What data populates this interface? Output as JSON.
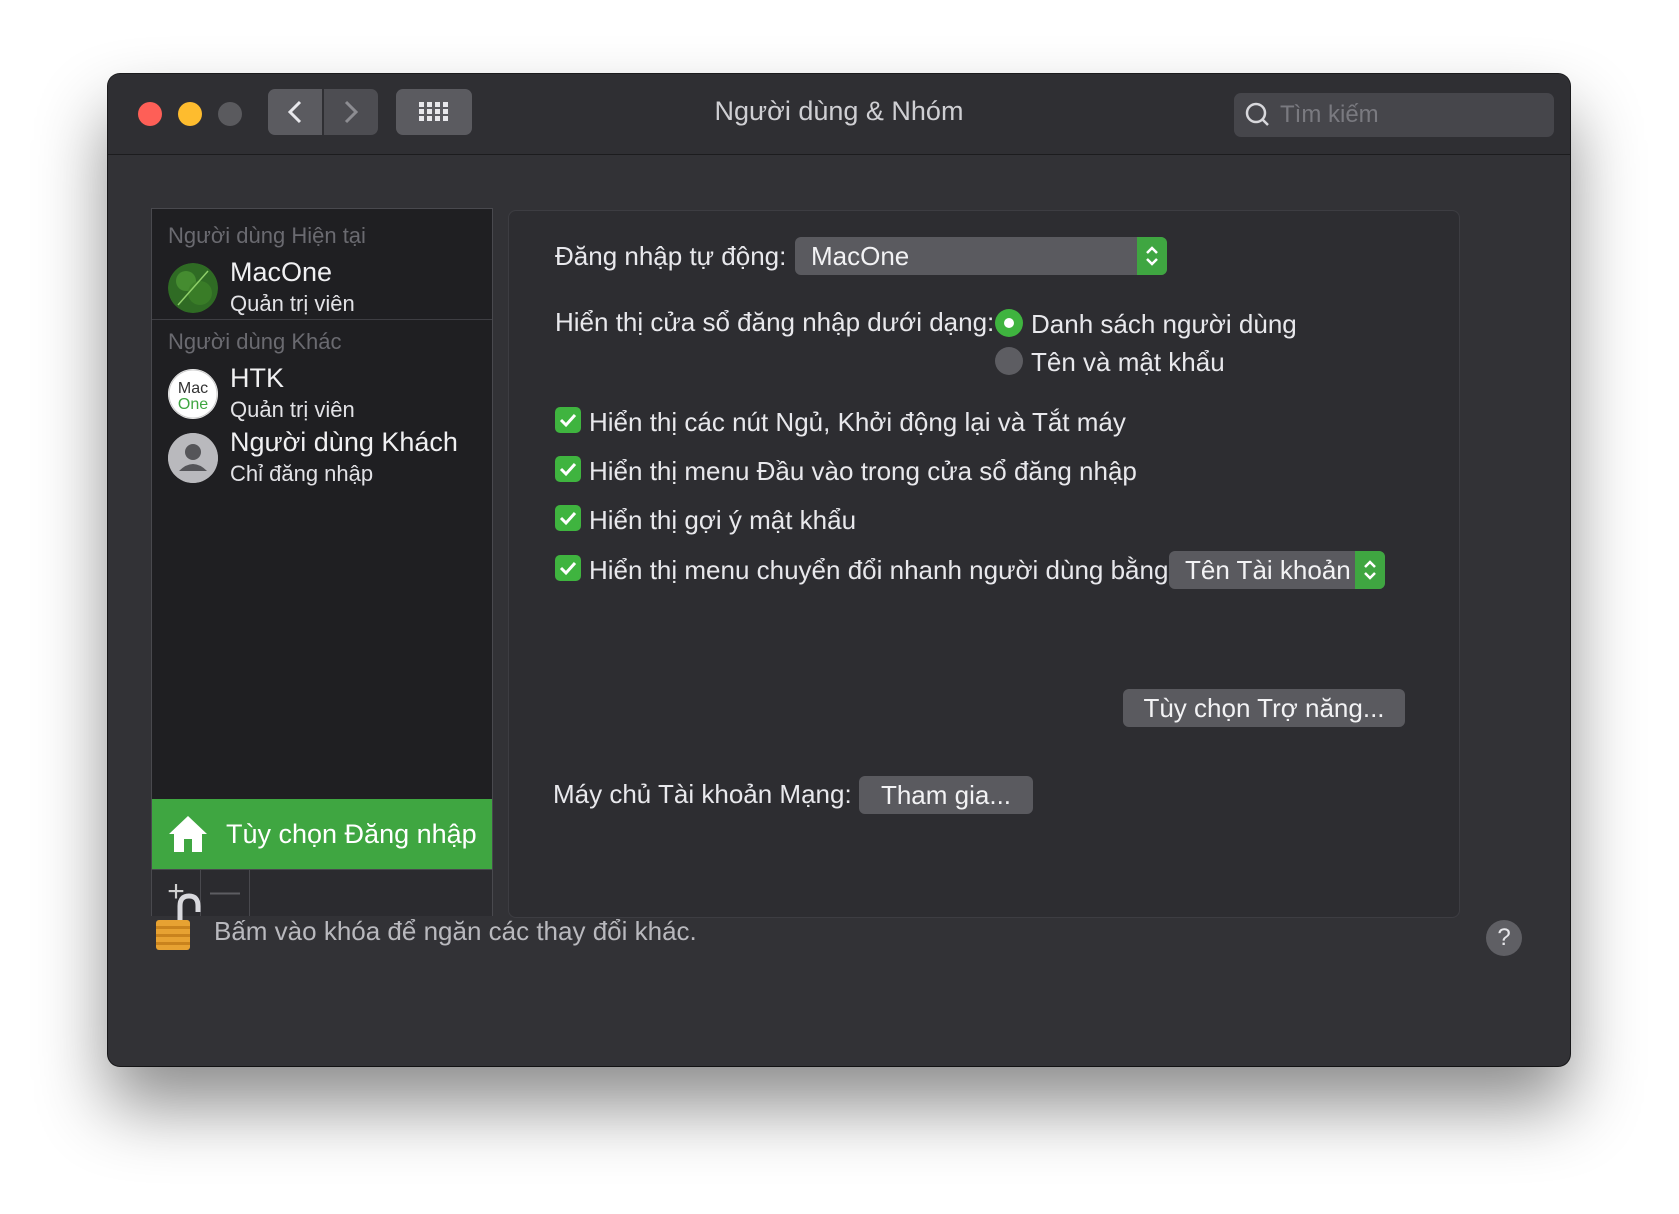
{
  "window": {
    "title": "Người dùng & Nhóm",
    "search_placeholder": "Tìm kiếm"
  },
  "sidebar": {
    "current_users_label": "Người dùng Hiện tại",
    "other_users_label": "Người dùng Khác",
    "users": [
      {
        "name": "MacOne",
        "role": "Quản trị viên"
      },
      {
        "name": "HTK",
        "role": "Quản trị viên",
        "avatar_text_1": "Mac",
        "avatar_text_2": "One"
      },
      {
        "name": "Người dùng Khách",
        "role": "Chỉ đăng nhập"
      }
    ],
    "login_options_label": "Tùy chọn Đăng nhập",
    "add_label": "+",
    "remove_label": "—"
  },
  "options": {
    "auto_login_label": "Đăng nhập tự động:",
    "auto_login_value": "MacOne",
    "display_label": "Hiển thị cửa sổ đăng nhập dưới dạng:",
    "radio_list": "Danh sách người dùng",
    "radio_name_password": "Tên và mật khẩu",
    "check_sleep": "Hiển thị các nút Ngủ, Khởi động lại và Tắt máy",
    "check_input_menu": "Hiển thị menu Đầu vào trong cửa sổ đăng nhập",
    "check_password_hint": "Hiển thị gợi ý mật khẩu",
    "check_fast_switch": "Hiển thị menu chuyển đổi nhanh người dùng bằng",
    "fast_switch_value": "Tên Tài khoản",
    "accessibility_button": "Tùy chọn Trợ năng...",
    "network_server_label": "Máy chủ Tài khoản Mạng:",
    "join_button": "Tham gia..."
  },
  "footer": {
    "lock_text": "Bấm vào khóa để ngăn các thay đổi khác.",
    "help_label": "?"
  },
  "colors": {
    "accent": "#3fa641",
    "window_bg": "#323236",
    "sidebar_bg": "#1f1f22"
  }
}
